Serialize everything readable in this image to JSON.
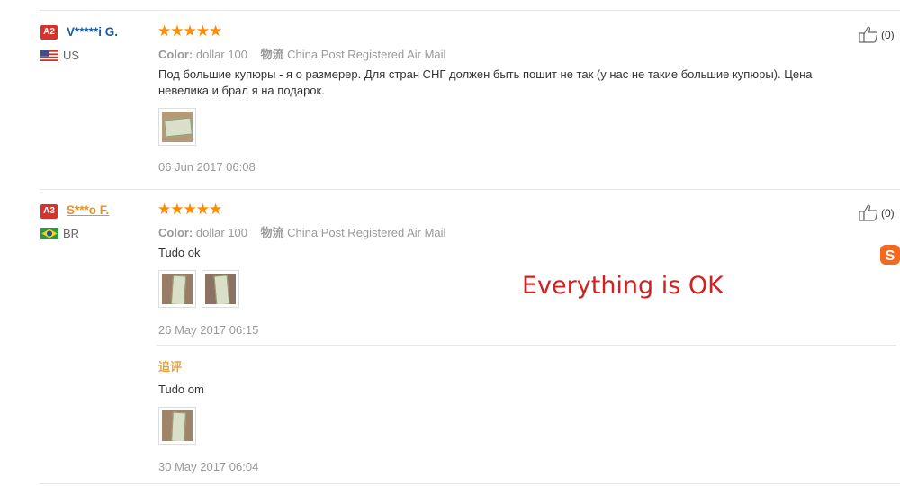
{
  "reviews": [
    {
      "level": "A2",
      "user": "V*****i G.",
      "country": "US",
      "stars": "★★★★★",
      "color_label": "Color:",
      "color_value": "dollar 100",
      "logistics_label": "物流",
      "logistics_value": "China Post Registered Air Mail",
      "text_line1": "Под большие купюры - я о размерер. Для стран СНГ должен быть пошит не так (у нас не такие большие купюры). Цена",
      "text_line2": "невелика и брал я на подарок.",
      "date": "06 Jun 2017 06:08",
      "likes": "(0)"
    },
    {
      "level": "A3",
      "user": "S***o F.",
      "country": "BR",
      "stars": "★★★★★",
      "color_label": "Color:",
      "color_value": "dollar 100",
      "logistics_label": "物流",
      "logistics_value": "China Post Registered Air Mail",
      "text": "Tudo ok",
      "date": "26 May 2017 06:15",
      "likes": "(0)",
      "followup_label": "追评",
      "followup_text": "Tudo om",
      "followup_date": "30 May 2017 06:04"
    }
  ],
  "overlay_text": "Everything is OK",
  "colors": {
    "star": "#ff8a00",
    "badge": "#d6342b",
    "user_blue": "#1a5aa6",
    "user_orange": "#e89321",
    "overlay": "#d32020"
  },
  "icons": [
    "thumbs-up-icon",
    "us-flag-icon",
    "br-flag-icon",
    "sogou-icon"
  ]
}
